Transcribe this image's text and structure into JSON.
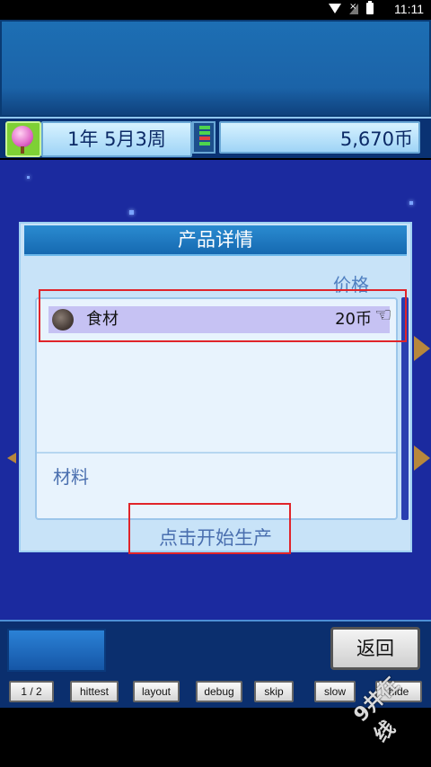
{
  "status_bar": {
    "time": "11:11"
  },
  "header": {
    "date": "1年 5月3周",
    "money": "5,670币"
  },
  "dialog": {
    "title": "产品详情",
    "price_header": "价格",
    "items": [
      {
        "name": "食材",
        "price": "20币",
        "icon": "ingredient-icon"
      }
    ],
    "materials_label": "材料",
    "start_label": "点击开始生产"
  },
  "footer": {
    "back_label": "返回",
    "debug_buttons": [
      "1 / 2",
      "hittest",
      "layout",
      "debug",
      "skip",
      "slow",
      "hide"
    ]
  },
  "watermark": "9井在线",
  "colors": {
    "highlight": "#e0242a",
    "dialog_bg": "#c8e3f8",
    "title_bar": "#1669b1",
    "background": "#1b2a9f"
  }
}
